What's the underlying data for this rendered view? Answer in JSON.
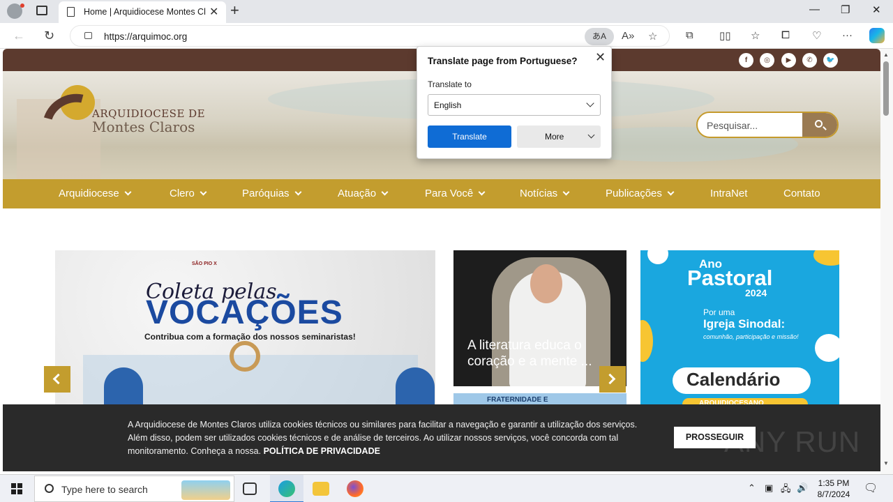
{
  "browser": {
    "tab_title": "Home | Arquidiocese Montes Claros",
    "url": "https://arquimoc.org",
    "translate_icon_glyph": "あA",
    "icons": [
      "profile-icon",
      "tab-actions-icon",
      "page-icon",
      "close-icon",
      "new-tab-icon",
      "minimize-icon",
      "maximize-icon",
      "window-close-icon",
      "back-icon",
      "refresh-icon",
      "lock-icon",
      "translate-icon",
      "read-aloud-icon",
      "favorite-star-icon",
      "extensions-icon",
      "split-screen-icon",
      "favorites-icon",
      "collections-icon",
      "browser-essentials-icon",
      "more-icon",
      "copilot-icon"
    ]
  },
  "site": {
    "colors": {
      "topbar": "#5c3a2e",
      "menu": "#c39d2e",
      "search_border": "#c59a2b"
    },
    "social": [
      "f",
      "◎",
      "▶",
      "✆",
      "🐦"
    ],
    "logo": {
      "line1": "ARQUIDIOCESE DE",
      "line2": "Montes Claros"
    },
    "search": {
      "placeholder": "Pesquisar..."
    },
    "menu": [
      {
        "label": "Arquidiocese",
        "dropdown": true
      },
      {
        "label": "Clero",
        "dropdown": true
      },
      {
        "label": "Paróquias",
        "dropdown": true
      },
      {
        "label": "Atuação",
        "dropdown": true
      },
      {
        "label": "Para Você",
        "dropdown": true
      },
      {
        "label": "Notícias",
        "dropdown": true
      },
      {
        "label": "Publicações",
        "dropdown": true
      },
      {
        "label": "IntraNet",
        "dropdown": false
      },
      {
        "label": "Contato",
        "dropdown": false
      }
    ],
    "slides": {
      "main": {
        "script": "Coleta pelas",
        "headline": "VOCAÇÕES",
        "subline": "Contribua com a formação dos nossos seminaristas!",
        "badge": "SÃO PIO X"
      },
      "news": {
        "title": "A literatura educa o coração e a mente ..."
      },
      "news2": {
        "caption": "FRATERNIDADE E"
      },
      "calendar": {
        "ano": "Ano",
        "pastoral": "Pastoral",
        "year": "2024",
        "por_uma": "Por uma",
        "sinodal": "Igreja Sinodal:",
        "sub": "comunhão, participação e missão!",
        "calendario": "Calendário",
        "arquidiocesano": "ARQUIDIOCESANO"
      }
    },
    "cookie": {
      "text": "A Arquidiocese de Montes Claros utiliza cookies técnicos ou similares para facilitar a navegação e garantir a utilização dos serviços. Além disso, podem ser utilizados cookies técnicos e de análise de terceiros. Ao utilizar nossos serviços, você concorda com tal monitoramento. Conheça a nossa.",
      "policy_link": "POLÍTICA DE PRIVACIDADE",
      "button": "PROSSEGUIR"
    },
    "watermark": "ANY RUN"
  },
  "translate_popup": {
    "heading": "Translate page from Portuguese?",
    "label": "Translate to",
    "selected_language": "English",
    "translate_button": "Translate",
    "more_button": "More"
  },
  "taskbar": {
    "search_placeholder": "Type here to search",
    "time": "1:35 PM",
    "date": "8/7/2024"
  }
}
